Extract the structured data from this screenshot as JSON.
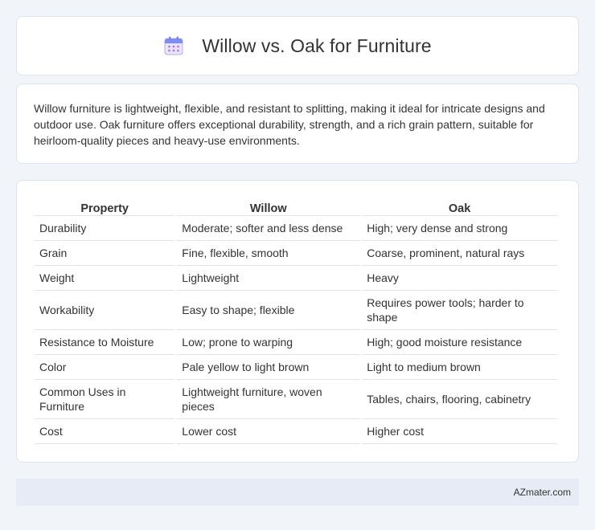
{
  "header": {
    "title": "Willow vs. Oak for Furniture",
    "icon": "calendar-icon"
  },
  "description": "Willow furniture is lightweight, flexible, and resistant to splitting, making it ideal for intricate designs and outdoor use. Oak furniture offers exceptional durability, strength, and a rich grain pattern, suitable for heirloom-quality pieces and heavy-use environments.",
  "table": {
    "headers": [
      "Property",
      "Willow",
      "Oak"
    ],
    "rows": [
      [
        "Durability",
        "Moderate; softer and less dense",
        "High; very dense and strong"
      ],
      [
        "Grain",
        "Fine, flexible, smooth",
        "Coarse, prominent, natural rays"
      ],
      [
        "Weight",
        "Lightweight",
        "Heavy"
      ],
      [
        "Workability",
        "Easy to shape; flexible",
        "Requires power tools; harder to shape"
      ],
      [
        "Resistance to Moisture",
        "Low; prone to warping",
        "High; good moisture resistance"
      ],
      [
        "Color",
        "Pale yellow to light brown",
        "Light to medium brown"
      ],
      [
        "Common Uses in Furniture",
        "Lightweight furniture, woven pieces",
        "Tables, chairs, flooring, cabinetry"
      ],
      [
        "Cost",
        "Lower cost",
        "Higher cost"
      ]
    ]
  },
  "footer": {
    "text": "AZmater.com"
  }
}
